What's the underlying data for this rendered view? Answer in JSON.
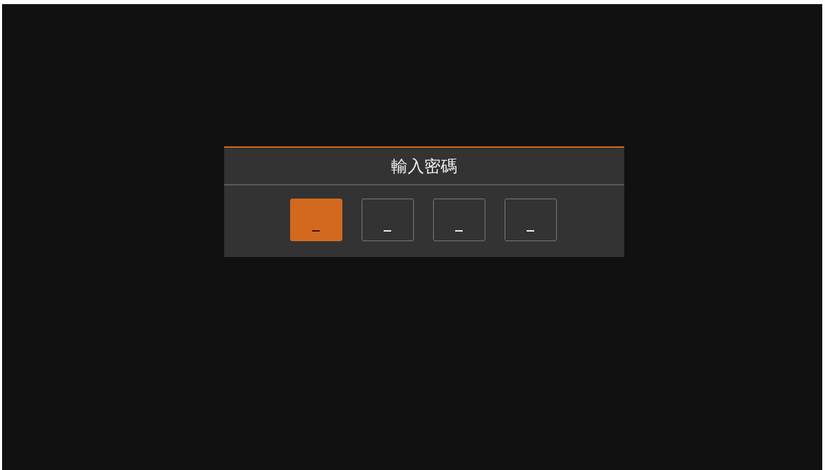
{
  "dialog": {
    "title": "輸入密碼",
    "digits": [
      {
        "value": "_",
        "selected": true
      },
      {
        "value": "_",
        "selected": false
      },
      {
        "value": "_",
        "selected": false
      },
      {
        "value": "_",
        "selected": false
      }
    ]
  }
}
